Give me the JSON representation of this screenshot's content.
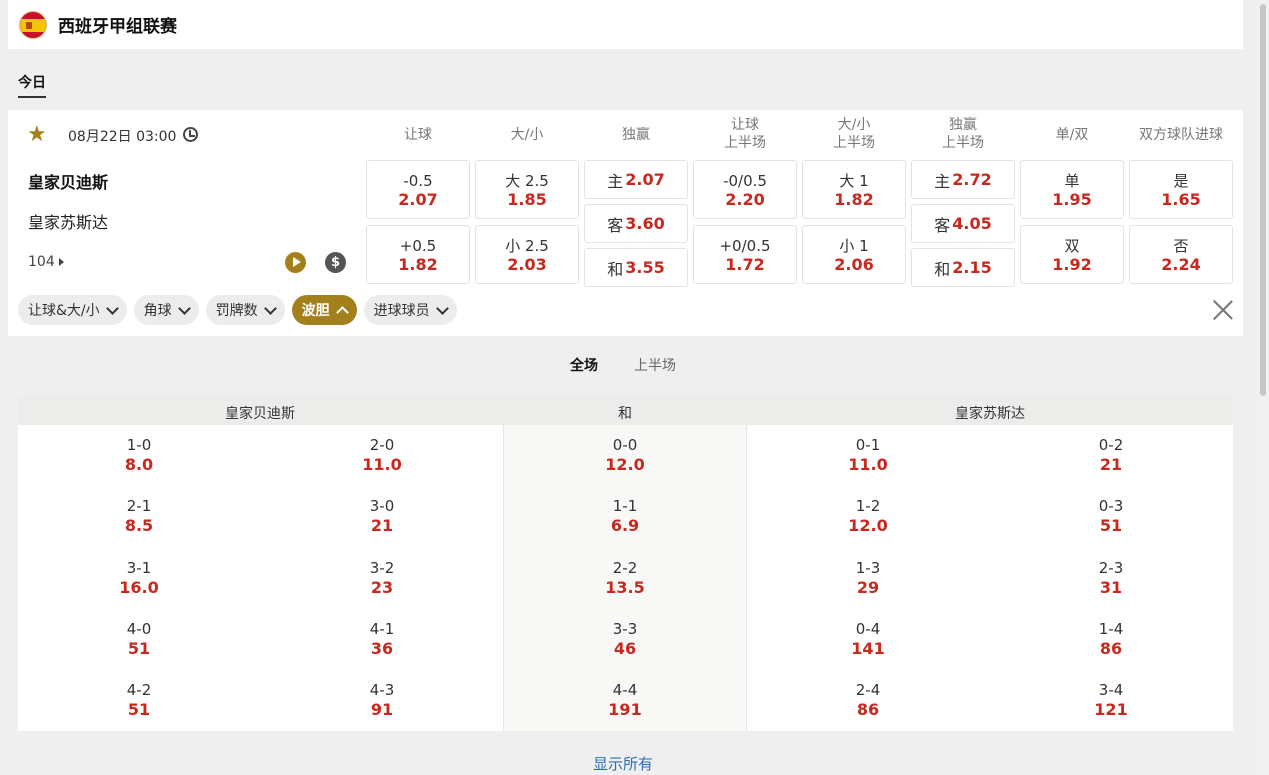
{
  "league": {
    "title": "西班牙甲组联赛",
    "flag_icon": "spain-flag-icon"
  },
  "tabs": {
    "today": "今日"
  },
  "match": {
    "time": "08月22日 03:00",
    "home": "皇家贝迪斯",
    "away": "皇家苏斯达",
    "more": "104"
  },
  "market_headers": [
    "让球",
    "大/小",
    "独赢",
    "让球\n上半场",
    "大/小\n上半场",
    "独赢\n上半场",
    "单/双",
    "双方球队进球"
  ],
  "markets": {
    "handicap": [
      {
        "label": "-0.5",
        "odd": "2.07"
      },
      {
        "label": "+0.5",
        "odd": "1.82"
      }
    ],
    "overunder": [
      {
        "label": "大 2.5",
        "odd": "1.85"
      },
      {
        "label": "小 2.5",
        "odd": "2.03"
      }
    ],
    "moneyline": [
      {
        "label": "主",
        "odd": "2.07"
      },
      {
        "label": "客",
        "odd": "3.60"
      },
      {
        "label": "和",
        "odd": "3.55"
      }
    ],
    "handicap_1h": [
      {
        "label": "-0/0.5",
        "odd": "2.20"
      },
      {
        "label": "+0/0.5",
        "odd": "1.72"
      }
    ],
    "overunder_1h": [
      {
        "label": "大 1",
        "odd": "1.82"
      },
      {
        "label": "小 1",
        "odd": "2.06"
      }
    ],
    "moneyline_1h": [
      {
        "label": "主",
        "odd": "2.72"
      },
      {
        "label": "客",
        "odd": "4.05"
      },
      {
        "label": "和",
        "odd": "2.15"
      }
    ],
    "oddeven": [
      {
        "label": "单",
        "odd": "1.95"
      },
      {
        "label": "双",
        "odd": "1.92"
      }
    ],
    "btts": [
      {
        "label": "是",
        "odd": "1.65"
      },
      {
        "label": "否",
        "odd": "2.24"
      }
    ]
  },
  "filters": [
    "让球&大/小",
    "角球",
    "罚牌数",
    "波胆",
    "进球球员"
  ],
  "active_filter": "波胆",
  "period_tabs": {
    "full": "全场",
    "half": "上半场"
  },
  "correct_score": {
    "headers": {
      "home": "皇家贝迪斯",
      "draw": "和",
      "away": "皇家苏斯达"
    },
    "home_a": [
      [
        "1-0",
        "8.0"
      ],
      [
        "2-1",
        "8.5"
      ],
      [
        "3-1",
        "16.0"
      ],
      [
        "4-0",
        "51"
      ],
      [
        "4-2",
        "51"
      ]
    ],
    "home_b": [
      [
        "2-0",
        "11.0"
      ],
      [
        "3-0",
        "21"
      ],
      [
        "3-2",
        "23"
      ],
      [
        "4-1",
        "36"
      ],
      [
        "4-3",
        "91"
      ]
    ],
    "draw": [
      [
        "0-0",
        "12.0"
      ],
      [
        "1-1",
        "6.9"
      ],
      [
        "2-2",
        "13.5"
      ],
      [
        "3-3",
        "46"
      ],
      [
        "4-4",
        "191"
      ]
    ],
    "away_a": [
      [
        "0-1",
        "11.0"
      ],
      [
        "1-2",
        "12.0"
      ],
      [
        "1-3",
        "29"
      ],
      [
        "0-4",
        "141"
      ],
      [
        "2-4",
        "86"
      ]
    ],
    "away_b": [
      [
        "0-2",
        "21"
      ],
      [
        "0-3",
        "51"
      ],
      [
        "2-3",
        "31"
      ],
      [
        "1-4",
        "86"
      ],
      [
        "3-4",
        "121"
      ]
    ]
  },
  "show_all": "显示所有",
  "colors": {
    "accent": "#a4801c",
    "odds": "#c8281e",
    "link": "#2c6fb8"
  }
}
